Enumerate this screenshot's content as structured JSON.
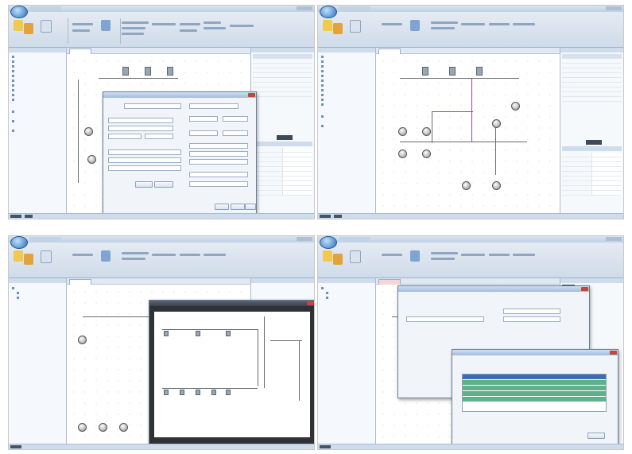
{
  "screenshots": [
    {
      "id": "s1",
      "view": "network-with-properties-dialog"
    },
    {
      "id": "s2",
      "view": "network-schematic"
    },
    {
      "id": "s3",
      "view": "network-with-profile-window"
    },
    {
      "id": "s4",
      "view": "network-with-results-table-dialog"
    }
  ],
  "colors": {
    "ribbon_top": "#e9eef5",
    "ribbon_bottom": "#cfdbe9",
    "pipe": "#6a6a6a",
    "pipe_highlight": "#7a55a8",
    "result_row_green": "#5fb08b",
    "result_row_blue": "#3b6fb5",
    "close_button": "#c8433a"
  },
  "icons": [
    "application-orb-icon",
    "node-icon",
    "pole-icon",
    "close-icon"
  ]
}
